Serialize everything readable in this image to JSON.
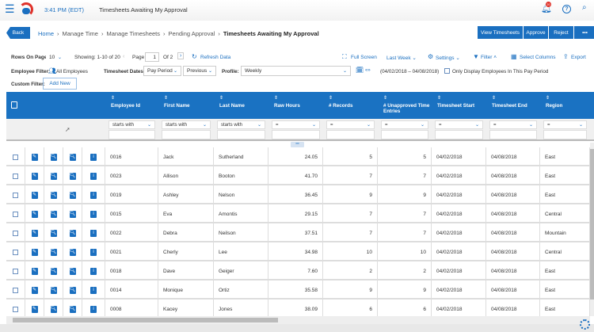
{
  "topbar": {
    "time": "3:41 PM (EDT)",
    "title": "Timesheets Awaiting My Approval",
    "notification_count": "20"
  },
  "breadcrumb": {
    "back": "Back",
    "items": [
      "Home",
      "Manage Time",
      "Manage Timesheets",
      "Pending Approval"
    ],
    "current": "Timesheets Awaiting My Approval"
  },
  "actions": {
    "view": "View Timesheets",
    "approve": "Approve",
    "reject": "Reject",
    "more": "•••"
  },
  "toolbar": {
    "rows_label": "Rows On Page",
    "rows_value": "10",
    "showing": "Showing: 1-10 of 20",
    "page_label": "Page",
    "page_value": "1",
    "of": "Of 2",
    "refresh": "Refresh Data",
    "fullscreen": "Full Screen",
    "last_week": "Last Week",
    "settings": "Settings",
    "filter": "Filter",
    "select_columns": "Select Columns",
    "export": "Export"
  },
  "filters": {
    "employee_label": "Employee Filter:",
    "employee_value": "All Employees",
    "dates_label": "Timesheet Dates:",
    "pay_period": "Pay Period",
    "previous": "Previous",
    "profile_label": "Profile:",
    "profile_value": "Weekly",
    "range": "(04/02/2018 – 04/08/2018)",
    "only_display": "Only Display Employees In This Pay Period",
    "custom_label": "Custom Filter:",
    "add_new": "Add New"
  },
  "columns": [
    "Employee Id",
    "First Name",
    "Last Name",
    "Raw Hours",
    "# Records",
    "# Unapproved Time Entries",
    "Timesheet Start",
    "Timesheet End",
    "Region"
  ],
  "column_filters": [
    "starts with",
    "starts with",
    "starts with",
    "=",
    "=",
    "=",
    "=",
    "=",
    "="
  ],
  "rows": [
    [
      "0016",
      "Jack",
      "Sutherland",
      "24.05",
      "5",
      "5",
      "04/02/2018",
      "04/08/2018",
      "East"
    ],
    [
      "0023",
      "Allison",
      "Booton",
      "41.70",
      "7",
      "7",
      "04/02/2018",
      "04/08/2018",
      "East"
    ],
    [
      "0019",
      "Ashley",
      "Nelson",
      "36.45",
      "9",
      "9",
      "04/02/2018",
      "04/08/2018",
      "East"
    ],
    [
      "0015",
      "Eva",
      "Amontis",
      "29.15",
      "7",
      "7",
      "04/02/2018",
      "04/08/2018",
      "Central"
    ],
    [
      "0022",
      "Debra",
      "Neilson",
      "37.51",
      "7",
      "7",
      "04/02/2018",
      "04/08/2018",
      "Mountain"
    ],
    [
      "0021",
      "Cherly",
      "Lee",
      "34.98",
      "10",
      "10",
      "04/02/2018",
      "04/08/2018",
      "Central"
    ],
    [
      "0018",
      "Dave",
      "Geiger",
      "7.60",
      "2",
      "2",
      "04/02/2018",
      "04/08/2018",
      "East"
    ],
    [
      "0014",
      "Monique",
      "Ortiz",
      "35.58",
      "9",
      "9",
      "04/02/2018",
      "04/08/2018",
      "East"
    ],
    [
      "0008",
      "Kacey",
      "Jones",
      "38.09",
      "6",
      "6",
      "04/02/2018",
      "04/08/2018",
      "East"
    ]
  ],
  "colors": {
    "primary": "#1a6fc0",
    "header": "#1a72c2"
  }
}
